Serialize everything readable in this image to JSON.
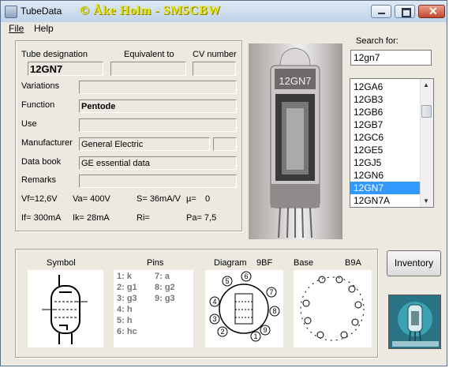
{
  "window": {
    "title": "TubeData",
    "title_overlay": "© Åke Holm - SM5CBW",
    "close_glyph": "✕"
  },
  "menu": {
    "file": "File",
    "help": "Help"
  },
  "details": {
    "designation_label": "Tube designation",
    "designation_value": "12GN7",
    "equivalent_label": "Equivalent to",
    "equivalent_value": "",
    "cv_label": "CV number",
    "cv_value": "",
    "variations_label": "Variations",
    "variations_value": "",
    "function_label": "Function",
    "function_value": "Pentode",
    "use_label": "Use",
    "use_value": "",
    "manufacturer_label": "Manufacturer",
    "manufacturer_value": "General Electric",
    "manufacturer_extra": "",
    "databook_label": "Data book",
    "databook_value": "GE essential data",
    "remarks_label": "Remarks",
    "remarks_value": "",
    "params_row1": [
      "Vf=12,6V",
      "Va= 400V",
      "S= 36mA/V",
      "µ=",
      "0"
    ],
    "params_row2": [
      "If= 300mA",
      "Ik= 28mA",
      "Ri=",
      "Pa= 7,5"
    ]
  },
  "photo": {
    "tube_print": "12GN7"
  },
  "search": {
    "label": "Search for:",
    "value": "12gn7",
    "results": [
      "12GA6",
      "12GB3",
      "12GB6",
      "12GB7",
      "12GC6",
      "12GE5",
      "12GJ5",
      "12GN6",
      "12GN7",
      "12GN7A"
    ],
    "selected_index": 8,
    "up_arrow": "▲",
    "down_arrow": "▼"
  },
  "bottom": {
    "symbol_label": "Symbol",
    "pins_label": "Pins",
    "pins_left": [
      "1: k",
      "2: g1",
      "3: g3",
      "4: h",
      "5: h",
      "6: hc"
    ],
    "pins_right": [
      "7: a",
      "8: g2",
      "9: g3"
    ],
    "diagram_label": "Diagram",
    "diagram_code": "9BF",
    "diagram_pins": [
      "1",
      "2",
      "3",
      "4",
      "5",
      "6",
      "7",
      "8",
      "9"
    ],
    "base_label": "Base",
    "base_code": "B9A"
  },
  "buttons": {
    "inventory": "Inventory"
  },
  "colors": {
    "selection": "#3399ff",
    "overlay_text": "#e9e400",
    "window_bg": "#ece9e0"
  }
}
